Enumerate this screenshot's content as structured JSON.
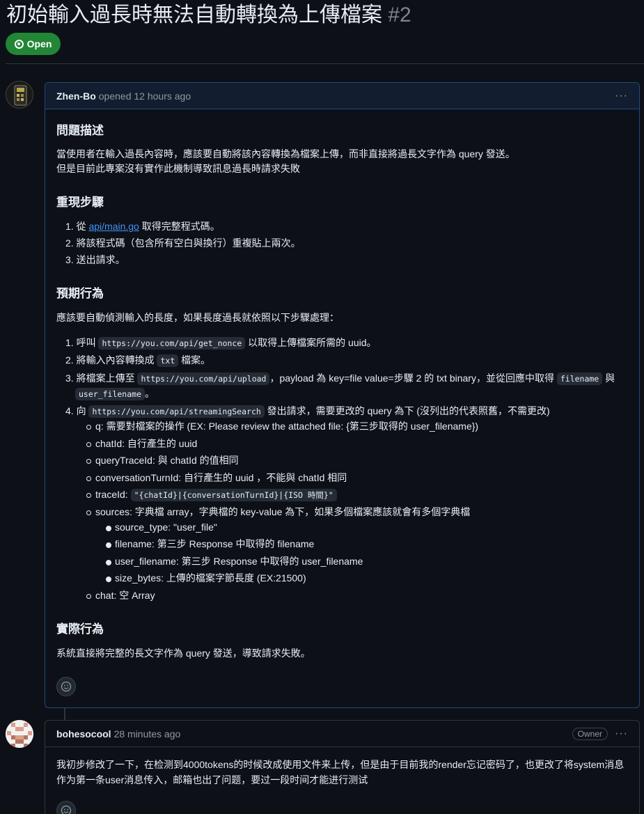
{
  "issue": {
    "title": "初始輸入過長時無法自動轉換為上傳檔案",
    "number": "#2",
    "state": "Open"
  },
  "comments": [
    {
      "author": "Zhen-Bo",
      "action": "opened",
      "time": "12 hours ago",
      "sections": {
        "desc_heading": "問題描述",
        "desc_line1": "當使用者在輸入過長內容時，應該要自動將該內容轉換為檔案上傳，而非直接將過長文字作為 query 發送。",
        "desc_line2": "但是目前此專案沒有實作此機制導致訊息過長時請求失敗",
        "repro_heading": "重現步驟",
        "repro": [
          {
            "num": "1.",
            "pre": "從 ",
            "link": "api/main.go",
            "post": " 取得完整程式碼。"
          },
          {
            "num": "2.",
            "text": "將該程式碼（包含所有空白與換行）重複貼上兩次。"
          },
          {
            "num": "3.",
            "text": "送出請求。"
          }
        ],
        "expected_heading": "預期行為",
        "expected_intro": "應該要自動偵測輸入的長度，如果長度過長就依照以下步驟處理：",
        "expected": {
          "s1": {
            "num": "1.",
            "pre": "呼叫 ",
            "code": "https://you.com/api/get_nonce",
            "post": " 以取得上傳檔案所需的 uuid。"
          },
          "s2": {
            "num": "2.",
            "pre": "將輸入內容轉換成 ",
            "code": "txt",
            "post": " 檔案。"
          },
          "s3": {
            "num": "3.",
            "pre": "將檔案上傳至 ",
            "code": "https://you.com/api/upload",
            "mid": "，payload 為 key=file value=步驟 2 的 txt binary，並從回應中取得 ",
            "code2": "filename",
            "post": " 與",
            "code3": "user_filename",
            "post2": "。"
          },
          "s4": {
            "num": "4.",
            "pre": "向 ",
            "code": "https://you.com/api/streamingSearch",
            "post": " 發出請求，需要更改的 query 為下 (沒列出的代表照舊，不需更改)"
          },
          "q": "q: 需要對檔案的操作 (EX: Please review the attached file: {第三步取得的 user_filename})",
          "chatId": "chatId: 自行產生的 uuid",
          "queryTraceId": "queryTraceId: 與 chatId 的值相同",
          "conversationTurnId": "conversationTurnId: 自行產生的 uuid ，不能與 chatId 相同",
          "traceId_pre": "traceId: ",
          "traceId_code": "\"{chatId}|{conversationTurnId}|{ISO 時間}\"",
          "sources": "sources: 字典檔 array，字典檔的 key-value 為下，如果多個檔案應該就會有多個字典檔",
          "source_type": "source_type: \"user_file\"",
          "filename": "filename: 第三步 Response 中取得的 filename",
          "user_filename": "user_filename: 第三步 Response 中取得的 user_filename",
          "size_bytes": "size_bytes: 上傳的檔案字節長度 (EX:21500)",
          "chat": "chat: 空 Array"
        },
        "actual_heading": "實際行為",
        "actual_text": "系統直接將完整的長文字作為 query 發送，導致請求失敗。"
      }
    },
    {
      "author": "bohesocool",
      "time": "28 minutes ago",
      "badge": "Owner",
      "line1": "我初步修改了一下，在检测到4000tokens的时候改成使用文件来上传，但是由于目前我的render忘记密码了，也更改了将system消息",
      "line2": "作为第一条user消息传入，邮箱也出了问题，要过一段时间才能进行测试"
    }
  ],
  "icons": {
    "state": "issue-opened-icon",
    "menu": "kebab-horizontal-icon",
    "reaction": "smiley-icon"
  },
  "colors": {
    "background": "#0d1117",
    "open_badge": "#238636",
    "link": "#4493f8",
    "highlight_border": "#1f4a80"
  }
}
